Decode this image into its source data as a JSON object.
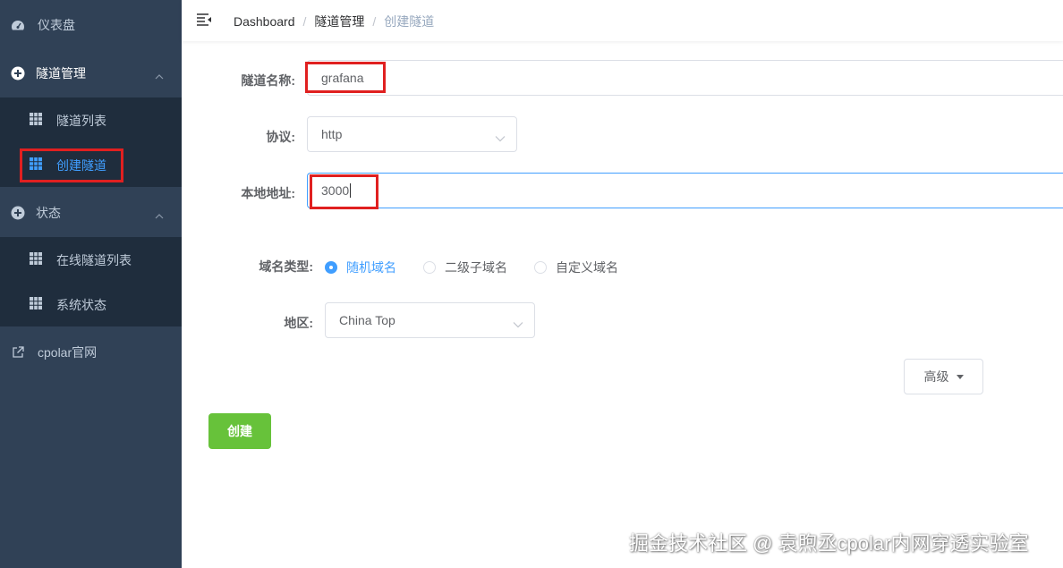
{
  "sidebar": {
    "dashboard": "仪表盘",
    "tunnel_mgmt": "隧道管理",
    "tunnel_list": "隧道列表",
    "create_tunnel": "创建隧道",
    "status": "状态",
    "online_tunnels": "在线隧道列表",
    "system_status": "系统状态",
    "cpolar_site": "cpolar官网"
  },
  "breadcrumb": {
    "home": "Dashboard",
    "section": "隧道管理",
    "current": "创建隧道",
    "separator": "/"
  },
  "form": {
    "name_label": "隧道名称:",
    "name_value": "grafana",
    "protocol_label": "协议:",
    "protocol_value": "http",
    "local_addr_label": "本地地址:",
    "local_addr_value": "3000",
    "domain_type_label": "域名类型:",
    "domain_options": [
      "随机域名",
      "二级子域名",
      "自定义域名"
    ],
    "domain_selected": "随机域名",
    "region_label": "地区:",
    "region_value": "China Top",
    "advanced_button": "高级",
    "create_button": "创建"
  },
  "watermark": "掘金技术社区 @ 袁煦丞cpolar内网穿透实验室",
  "colors": {
    "sidebar_bg": "#304156",
    "submenu_bg": "#1f2d3d",
    "accent": "#409eff",
    "success": "#67c23a",
    "highlight": "#e02020"
  }
}
